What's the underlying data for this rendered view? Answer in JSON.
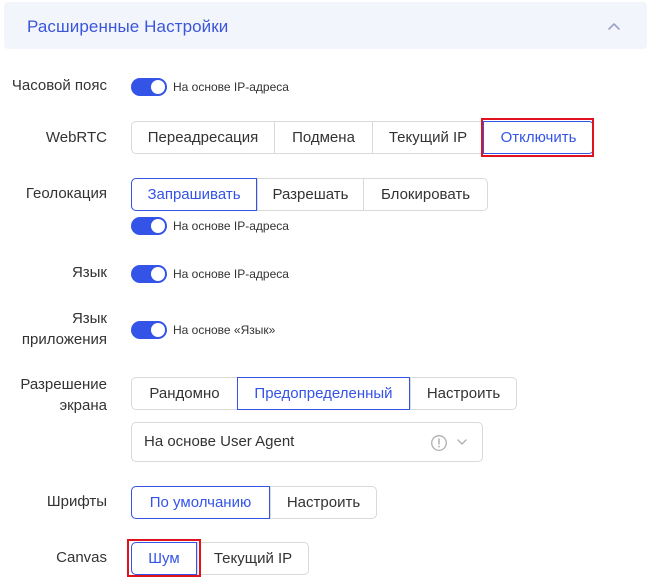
{
  "header": {
    "title": "Расширенные Настройки",
    "collapse_icon": "chevron-up-icon"
  },
  "colors": {
    "accent": "#3454e8",
    "highlight": "#e0121e",
    "header_bg": "#f3f5fc"
  },
  "timezone": {
    "label": "Часовой пояс",
    "toggle_on": true,
    "toggle_text": "На основе IP-адреса"
  },
  "webrtc": {
    "label": "WebRTC",
    "options": [
      "Переадресация",
      "Подмена",
      "Текущий IP",
      "Отключить"
    ],
    "selected": "Отключить"
  },
  "geolocation": {
    "label": "Геолокация",
    "options": [
      "Запрашивать",
      "Разрешать",
      "Блокировать"
    ],
    "selected": "Запрашивать",
    "toggle_on": true,
    "toggle_text": "На основе IP-адреса"
  },
  "language": {
    "label": "Язык",
    "toggle_on": true,
    "toggle_text": "На основе IP-адреса"
  },
  "app_language": {
    "label_line1": "Язык",
    "label_line2": "приложения",
    "toggle_on": true,
    "toggle_text": "На основе «Язык»"
  },
  "resolution": {
    "label_line1": "Разрешение",
    "label_line2": "экрана",
    "options": [
      "Рандомно",
      "Предопределенный",
      "Настроить"
    ],
    "selected": "Предопределенный",
    "select_value": "На основе User Agent"
  },
  "fonts": {
    "label": "Шрифты",
    "options": [
      "По умолчанию",
      "Настроить"
    ],
    "selected": "По умолчанию"
  },
  "canvas": {
    "label": "Canvas",
    "options": [
      "Шум",
      "Текущий IP"
    ],
    "selected": "Шум"
  }
}
